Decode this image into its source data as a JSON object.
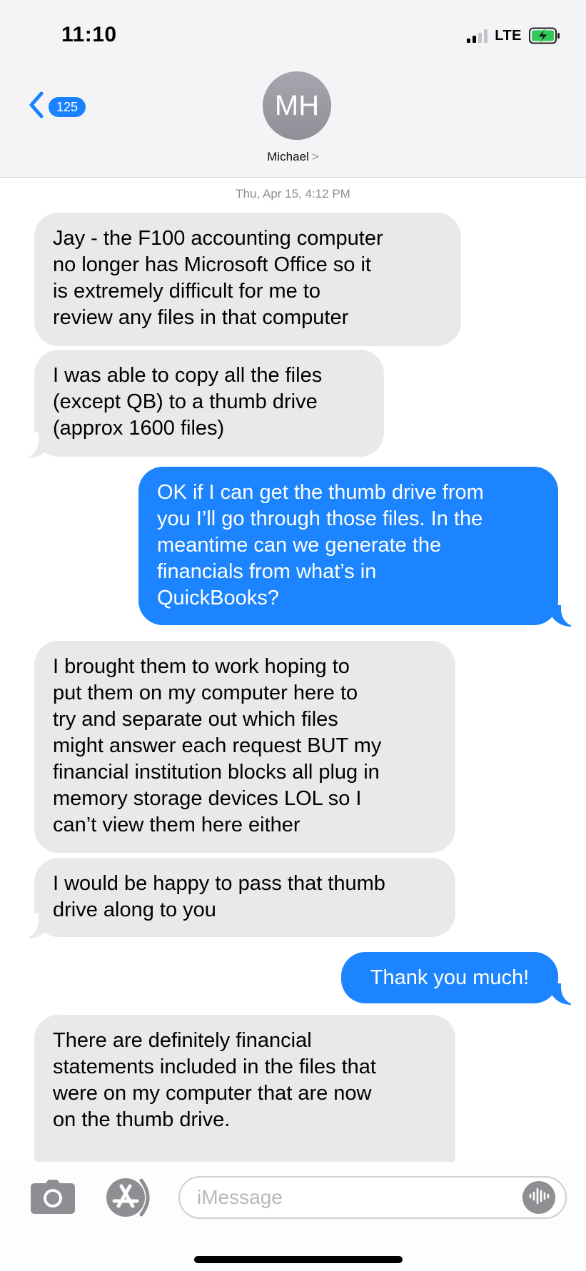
{
  "status_bar": {
    "time": "11:10",
    "network": "LTE"
  },
  "header": {
    "back_count": "125",
    "avatar_initials": "MH",
    "contact_name": "Michael",
    "contact_chevron": ">"
  },
  "thread": {
    "timestamp": "Thu, Apr 15, 4:12 PM",
    "messages": [
      {
        "direction": "incoming",
        "text": "Jay - the F100 accounting computer\nno longer has Microsoft Office so it\nis extremely difficult for me to\nreview any files in that computer"
      },
      {
        "direction": "incoming",
        "text": "I was able to copy all the files\n(except QB) to a thumb drive\n(approx 1600 files)"
      },
      {
        "direction": "outgoing",
        "text": "OK if I can get the thumb drive from\nyou I’ll go through those files. In the\nmeantime can we generate the\nfinancials from what’s in\nQuickBooks?"
      },
      {
        "direction": "incoming",
        "text": "I brought them to work hoping to\nput them on my computer here to\ntry and separate out which files\nmight answer each request BUT my\nfinancial institution blocks all plug in\nmemory storage devices LOL so I\ncan’t view them here either"
      },
      {
        "direction": "incoming",
        "text": "I would be happy to pass that thumb\ndrive along to you"
      },
      {
        "direction": "outgoing",
        "text": "Thank you much!"
      },
      {
        "direction": "incoming",
        "text": "There are definitely financial\nstatements included in the files that\nwere on my computer that are now\non the thumb drive."
      }
    ]
  },
  "input_bar": {
    "placeholder": "iMessage",
    "value": ""
  },
  "colors": {
    "accent_blue": "#1b84fe",
    "incoming_gray": "#e9e9eb",
    "battery_charging_green": "#34c759"
  },
  "icons": {
    "back": "chevron-left-icon",
    "camera": "camera-icon",
    "app_store": "app-store-icon",
    "audio": "audio-waveform-icon",
    "battery": "battery-charging-icon",
    "signal": "cellular-signal-icon"
  }
}
